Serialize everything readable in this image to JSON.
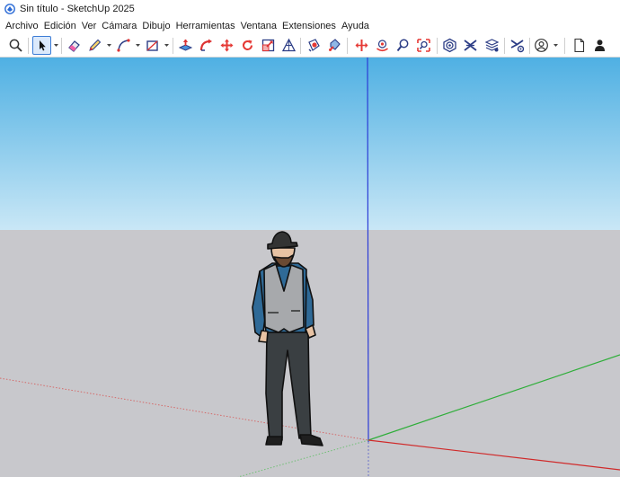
{
  "window": {
    "title": "Sin título - SketchUp 2025",
    "colors": {
      "sky_top": "#4fb0e3",
      "sky_bottom": "#c9e7f6",
      "ground": "#c8c8cc",
      "accent_red": "#e53935",
      "blue_axis": "#2b3bd6",
      "green_axis": "#2fae3a",
      "red_axis": "#d02a2a"
    }
  },
  "menu": {
    "items": [
      "Archivo",
      "Edición",
      "Ver",
      "Cámara",
      "Dibujo",
      "Herramientas",
      "Ventana",
      "Extensiones",
      "Ayuda"
    ]
  },
  "toolbar": {
    "tools": [
      {
        "icon": "search-icon"
      },
      {
        "icon": "select-arrow-icon",
        "selected": true
      },
      {
        "icon": "eraser-icon"
      },
      {
        "icon": "pencil-icon"
      },
      {
        "icon": "line-icon"
      },
      {
        "icon": "rectangle-icon"
      },
      {
        "icon": "push-pull-icon"
      },
      {
        "icon": "follow-me-icon"
      },
      {
        "icon": "move-icon"
      },
      {
        "icon": "rotate-icon"
      },
      {
        "icon": "scale-icon"
      },
      {
        "icon": "protractor-icon"
      },
      {
        "icon": "paint-bucket-icon"
      },
      {
        "icon": "tag-icon"
      },
      {
        "icon": "section-plane-icon"
      },
      {
        "icon": "orbit-icon"
      },
      {
        "icon": "zoom-icon"
      },
      {
        "icon": "zoom-extents-icon"
      },
      {
        "icon": "3d-warehouse-icon"
      },
      {
        "icon": "extension-warehouse-icon"
      },
      {
        "icon": "layers-icon"
      },
      {
        "icon": "layers-gear-icon"
      },
      {
        "icon": "extension-manager-icon"
      },
      {
        "icon": "account-icon"
      },
      {
        "icon": "new-document-icon"
      },
      {
        "icon": "user-icon"
      }
    ]
  }
}
